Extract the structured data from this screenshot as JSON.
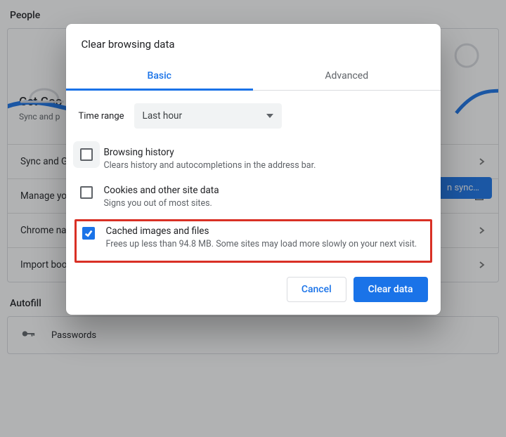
{
  "page": {
    "section1_title": "People",
    "hero_title": "Get Goo",
    "hero_sub": "Sync and p",
    "sync_button": "n sync…",
    "rows": {
      "sync": "Sync and G",
      "manage": "Manage yo",
      "chrome": "Chrome na",
      "import": "Import boo"
    },
    "section2_title": "Autofill",
    "passwords": "Passwords"
  },
  "dialog": {
    "title": "Clear browsing data",
    "tabs": {
      "basic": "Basic",
      "advanced": "Advanced"
    },
    "time_range_label": "Time range",
    "time_range_value": "Last hour",
    "opt1": {
      "title": "Browsing history",
      "desc": "Clears history and autocompletions in the address bar."
    },
    "opt2": {
      "title": "Cookies and other site data",
      "desc": "Signs you out of most sites."
    },
    "opt3": {
      "title": "Cached images and files",
      "desc": "Frees up less than 94.8 MB. Some sites may load more slowly on your next visit."
    },
    "cancel": "Cancel",
    "clear": "Clear data"
  }
}
